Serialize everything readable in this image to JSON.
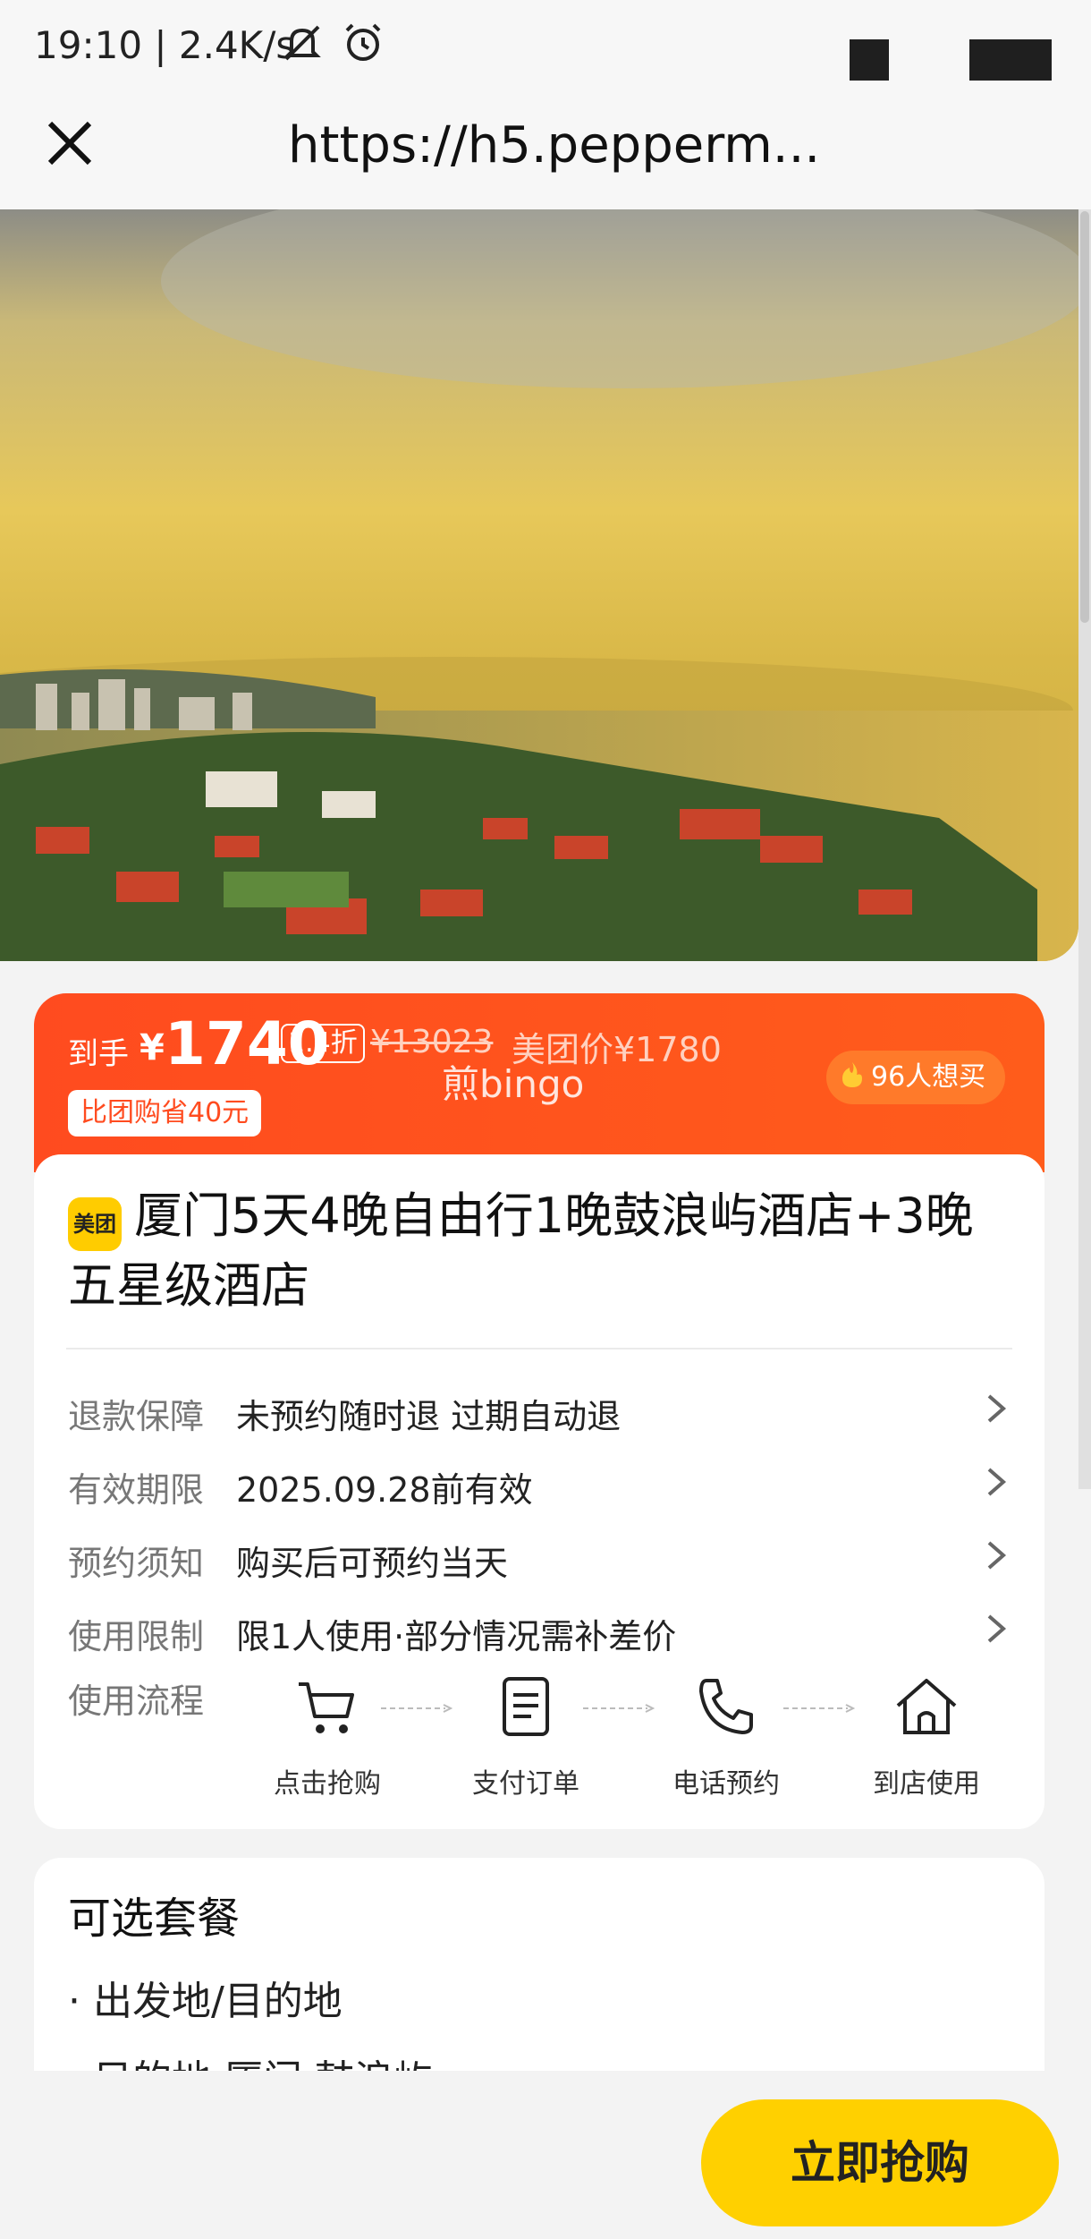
{
  "status_bar": {
    "time_speed": "19:10 | 2.4K/s",
    "icons": [
      "mute-icon",
      "alarm-icon"
    ]
  },
  "browser": {
    "url": "https://h5.pepperm..."
  },
  "price": {
    "daoshou_label": "到手",
    "currency": "¥",
    "amount": "1740",
    "discount": "1.4折",
    "original_price": "¥13023",
    "meituan_price": "美团价¥1780",
    "save_text": "比团购省40元",
    "watermark": "煎bingo",
    "want_count": "96人想买"
  },
  "product": {
    "brand_logo": "美团",
    "title": "厦门5天4晚自由行1晚鼓浪屿酒店+3晚五星级酒店"
  },
  "info_rows": [
    {
      "label": "退款保障",
      "value": "未预约随时退 过期自动退"
    },
    {
      "label": "有效期限",
      "value": "2025.09.28前有效"
    },
    {
      "label": "预约须知",
      "value": "购买后可预约当天"
    },
    {
      "label": "使用限制",
      "value": "限1人使用·部分情况需补差价"
    }
  ],
  "process": {
    "label": "使用流程",
    "steps": [
      {
        "label": "点击抢购",
        "icon": "cart-icon"
      },
      {
        "label": "支付订单",
        "icon": "document-icon"
      },
      {
        "label": "电话预约",
        "icon": "phone-icon"
      },
      {
        "label": "到店使用",
        "icon": "house-icon"
      }
    ]
  },
  "packages": {
    "title": "可选套餐",
    "items": [
      "出发地/目的地",
      "目的地 厦门 鼓浪屿"
    ]
  },
  "cta": {
    "buy_label": "立即抢购"
  },
  "colors": {
    "price_banner": "#ff4b1f",
    "cta": "#ffd000",
    "brand_yellow": "#ffcc00"
  }
}
